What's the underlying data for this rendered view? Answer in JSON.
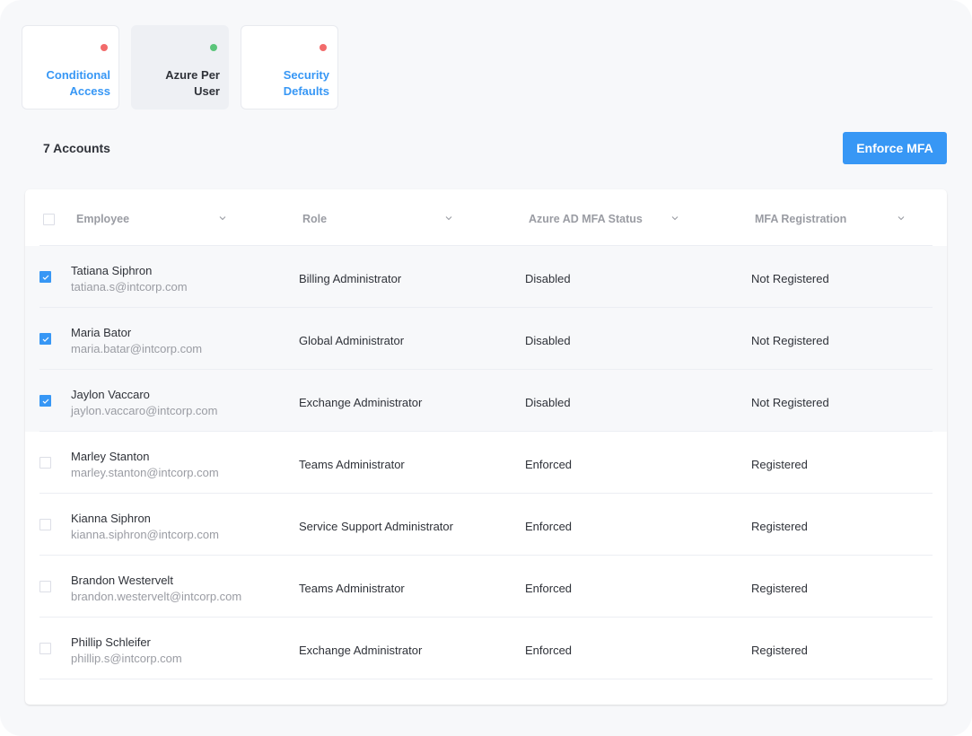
{
  "tabs": [
    {
      "label_line1": "Conditional",
      "label_line2": "Access",
      "status": "inactive",
      "status_color": "#f26b6b",
      "active": false
    },
    {
      "label_line1": "Azure Per",
      "label_line2": "User",
      "status": "active",
      "status_color": "#5bc57a",
      "active": true
    },
    {
      "label_line1": "Security",
      "label_line2": "Defaults",
      "status": "inactive",
      "status_color": "#f26b6b",
      "active": false
    }
  ],
  "toolbar": {
    "count_label": "7 Accounts",
    "enforce_label": "Enforce MFA"
  },
  "colors": {
    "accent": "#3797f5",
    "status_red": "#f26b6b",
    "status_green": "#5bc57a"
  },
  "table": {
    "columns": [
      "Employee",
      "Role",
      "Azure AD MFA Status",
      "MFA Registration"
    ],
    "rows": [
      {
        "name": "Tatiana Siphron",
        "email": "tatiana.s@intcorp.com",
        "role": "Billing Administrator",
        "status": "Disabled",
        "registration": "Not Registered",
        "checked": true
      },
      {
        "name": "Maria Bator",
        "email": "maria.batar@intcorp.com",
        "role": "Global Administrator",
        "status": "Disabled",
        "registration": "Not Registered",
        "checked": true
      },
      {
        "name": "Jaylon Vaccaro",
        "email": "jaylon.vaccaro@intcorp.com",
        "role": "Exchange Administrator",
        "status": "Disabled",
        "registration": "Not Registered",
        "checked": true
      },
      {
        "name": "Marley Stanton",
        "email": "marley.stanton@intcorp.com",
        "role": "Teams Administrator",
        "status": "Enforced",
        "registration": "Registered",
        "checked": false
      },
      {
        "name": "Kianna Siphron",
        "email": "kianna.siphron@intcorp.com",
        "role": "Service Support Administrator",
        "status": "Enforced",
        "registration": "Registered",
        "checked": false
      },
      {
        "name": "Brandon Westervelt",
        "email": "brandon.westervelt@intcorp.com",
        "role": "Teams Administrator",
        "status": "Enforced",
        "registration": "Registered",
        "checked": false
      },
      {
        "name": "Phillip Schleifer",
        "email": "phillip.s@intcorp.com",
        "role": "Exchange Administrator",
        "status": "Enforced",
        "registration": "Registered",
        "checked": false
      }
    ]
  }
}
